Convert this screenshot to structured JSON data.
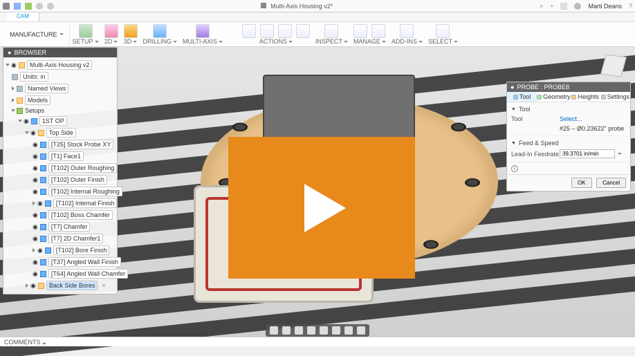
{
  "title": "Multi-Axis Housing v2*",
  "user": "Marti Deans",
  "doc_tabs": [
    "CAM"
  ],
  "workspace": "MANUFACTURE",
  "ribbon": [
    {
      "label": "SETUP"
    },
    {
      "label": "2D"
    },
    {
      "label": "3D"
    },
    {
      "label": "DRILLING"
    },
    {
      "label": "MULTI-AXIS"
    },
    {
      "label": "ACTIONS"
    },
    {
      "label": "INSPECT"
    },
    {
      "label": "MANAGE"
    },
    {
      "label": "ADD-INS"
    },
    {
      "label": "SELECT"
    }
  ],
  "browser": {
    "title": "BROWSER",
    "root": "Multi-Axis Housing v2",
    "units": "Units: in",
    "named_views": "Named Views",
    "models": "Models",
    "setups": "Setups",
    "setup1": "1ST OP",
    "topside": "Top Side",
    "ops": [
      "[T25] Stock Probe XY",
      "[T1] Face1",
      "[T102] Outer Roughing",
      "[T102] Outer Finish",
      "[T102] Internal Roughing",
      "[T102] Internal Finish",
      "[T102] Boss Chamfer",
      "[T7] Chamfer",
      "[T7] 2D Chamfer1",
      "[T102] Bore Finish",
      "[T37] Angled Wall Finish",
      "[T64] Angled Wall Chamfer"
    ],
    "back_side": "Back Side Bores"
  },
  "probe": {
    "title": "PROBE : PROBE8",
    "tabs": [
      "Tool",
      "Geometry",
      "Heights",
      "Settings"
    ],
    "section_tool": "Tool",
    "tool_label": "Tool",
    "tool_select": "Select...",
    "tool_desc": "#25 – Ø0.23622\" probe",
    "section_feed": "Feed & Speed",
    "feedrate_label": "Lead-In Feedrate",
    "feedrate_value": "39.3701 in/min",
    "ok": "OK",
    "cancel": "Cancel"
  },
  "bottom": {
    "status": "COMMENTS"
  }
}
